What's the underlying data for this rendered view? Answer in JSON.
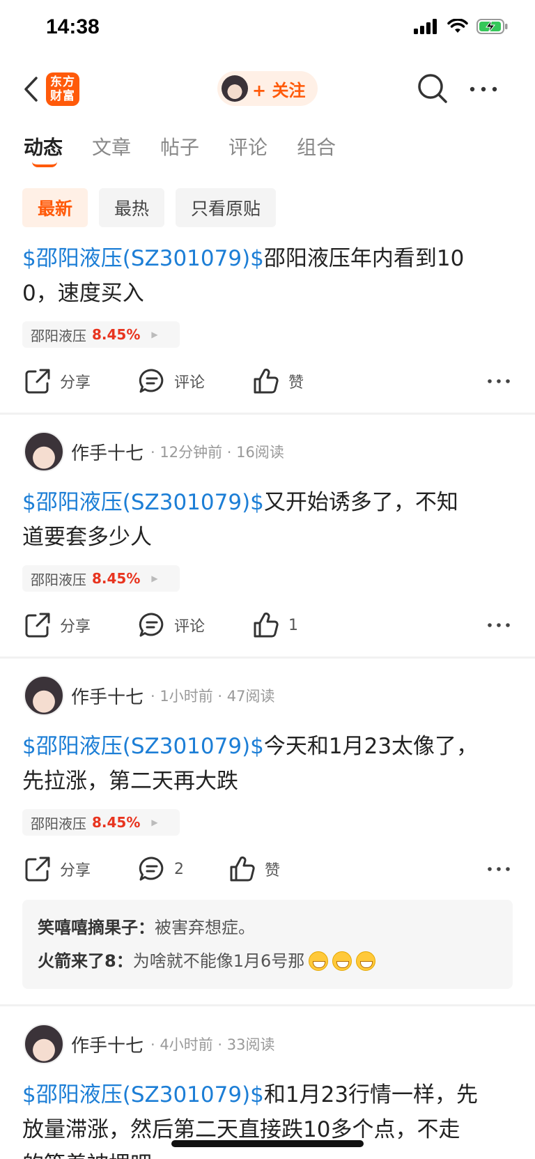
{
  "status": {
    "time": "14:38"
  },
  "header": {
    "logo_line1": "东方",
    "logo_line2": "财富",
    "follow_label": "+ 关注"
  },
  "tabs": [
    {
      "label": "动态",
      "active": true
    },
    {
      "label": "文章",
      "active": false
    },
    {
      "label": "帖子",
      "active": false
    },
    {
      "label": "评论",
      "active": false
    },
    {
      "label": "组合",
      "active": false
    }
  ],
  "filters": [
    {
      "label": "最新",
      "active": true
    },
    {
      "label": "最热",
      "active": false
    },
    {
      "label": "只看原贴",
      "active": false
    }
  ],
  "posts": [
    {
      "author": "",
      "time": "",
      "reads": "",
      "stock_tag": "$邵阳液压(SZ301079)$",
      "text_line1": "邵阳液压年内看到10",
      "text_line2": "0，速度买入",
      "stock_name": "邵阳液压",
      "stock_pct": "8.45%",
      "share": "分享",
      "comment": "评论",
      "like": "赞"
    },
    {
      "author": "作手十七",
      "time": "12分钟前",
      "reads": "16阅读",
      "stock_tag": "$邵阳液压(SZ301079)$",
      "text_line1": "又开始诱多了，不知",
      "text_line2": "道要套多少人",
      "stock_name": "邵阳液压",
      "stock_pct": "8.45%",
      "share": "分享",
      "comment": "评论",
      "like": "1"
    },
    {
      "author": "作手十七",
      "time": "1小时前",
      "reads": "47阅读",
      "stock_tag": "$邵阳液压(SZ301079)$",
      "text_line1": "今天和1月23太像了，",
      "text_line2": "先拉涨，第二天再大跌",
      "stock_name": "邵阳液压",
      "stock_pct": "8.45%",
      "share": "分享",
      "comment": "2",
      "like": "赞",
      "comments": [
        {
          "author": "笑嘻嘻摘果子",
          "text": "被害弃想症。"
        },
        {
          "author": "火箭来了8",
          "text": "为啥就不能像1月6号那"
        }
      ]
    },
    {
      "author": "作手十七",
      "time": "4小时前",
      "reads": "33阅读",
      "stock_tag": "$邵阳液压(SZ301079)$",
      "text_line1": "和1月23行情一样，先",
      "text_line2": "放量滞涨，然后第二天直接跌10多个点，不走",
      "text_line3": "的等着被埋吧"
    }
  ]
}
